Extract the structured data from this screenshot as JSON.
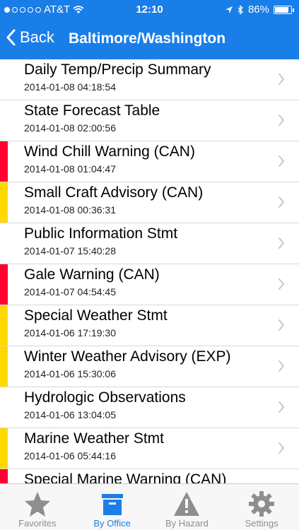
{
  "status": {
    "carrier": "AT&T",
    "time": "12:10",
    "battery": "86%",
    "signal_bars_filled": 1
  },
  "nav": {
    "back_label": "Back",
    "title": "Baltimore/Washington"
  },
  "colors": {
    "accent": "#1a7ee8",
    "warning": "#ff0033",
    "advisory": "#ffd800"
  },
  "rows": [
    {
      "name": "Daily Temp/Precip Summary",
      "date": "2014-01-08 04:18:54",
      "severity": "none"
    },
    {
      "name": "State Forecast Table",
      "date": "2014-01-08 02:00:56",
      "severity": "none"
    },
    {
      "name": "Wind Chill Warning (CAN)",
      "date": "2014-01-08 01:04:47",
      "severity": "red"
    },
    {
      "name": "Small Craft Advisory (CAN)",
      "date": "2014-01-08 00:36:31",
      "severity": "yellow"
    },
    {
      "name": "Public Information Stmt",
      "date": "2014-01-07 15:40:28",
      "severity": "none"
    },
    {
      "name": "Gale Warning (CAN)",
      "date": "2014-01-07 04:54:45",
      "severity": "red"
    },
    {
      "name": "Special Weather Stmt",
      "date": "2014-01-06 17:19:30",
      "severity": "yellow"
    },
    {
      "name": "Winter Weather Advisory (EXP)",
      "date": "2014-01-06 15:30:06",
      "severity": "yellow"
    },
    {
      "name": "Hydrologic Observations",
      "date": "2014-01-06 13:04:05",
      "severity": "none"
    },
    {
      "name": "Marine Weather Stmt",
      "date": "2014-01-06 05:44:16",
      "severity": "yellow"
    },
    {
      "name": "Special Marine Warning (CAN)",
      "date": "",
      "severity": "red"
    }
  ],
  "tabs": [
    {
      "label": "Favorites",
      "icon": "star-icon",
      "active": false
    },
    {
      "label": "By Office",
      "icon": "inbox-icon",
      "active": true
    },
    {
      "label": "By Hazard",
      "icon": "warning-icon",
      "active": false
    },
    {
      "label": "Settings",
      "icon": "gear-icon",
      "active": false
    }
  ]
}
